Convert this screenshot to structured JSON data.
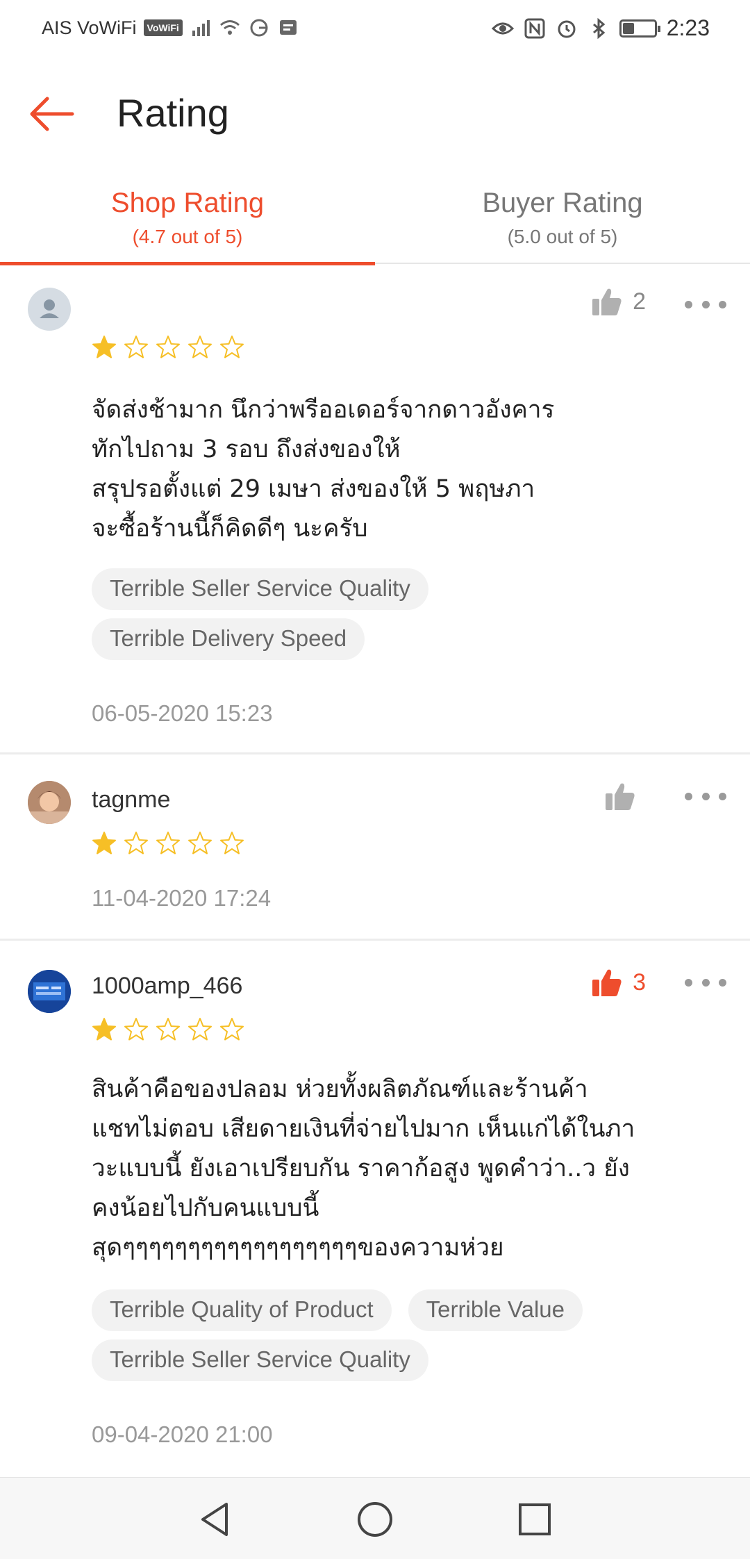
{
  "status_bar": {
    "carrier": "AIS VoWiFi",
    "vowifi_badge": "VoWiFi",
    "time": "2:23",
    "battery_level": 0.35
  },
  "header": {
    "title": "Rating",
    "back_icon": "back-arrow-icon"
  },
  "tabs": [
    {
      "label": "Shop Rating",
      "sublabel": "(4.7 out of 5)",
      "active": true
    },
    {
      "label": "Buyer Rating",
      "sublabel": "(5.0 out of 5)",
      "active": false
    }
  ],
  "reviews": [
    {
      "username": "",
      "avatar": "default-user",
      "likes": "2",
      "liked": false,
      "rating": 1,
      "comment": [
        "จัดส่งช้ามาก นึกว่าพรีออเดอร์จากดาวอังคาร",
        "ทักไปถาม 3 รอบ ถึงส่งของให้",
        "สรุปรอตั้งแต่ 29 เมษา ส่งของให้ 5 พฤษภา",
        "จะซื้อร้านนี้ก็คิดดีๆ นะครับ"
      ],
      "tags": [
        "Terrible Seller Service Quality",
        "Terrible Delivery Speed"
      ],
      "date": "06-05-2020 15:23"
    },
    {
      "username": "tagnme",
      "avatar": "photo",
      "likes": "",
      "liked": false,
      "rating": 1,
      "comment": [],
      "tags": [],
      "date": "11-04-2020 17:24"
    },
    {
      "username": "1000amp_466",
      "avatar": "photo",
      "likes": "3",
      "liked": true,
      "rating": 1,
      "comment": [
        "สินค้าคือของปลอม ห่วยทั้งผลิตภัณฑ์และร้านค้า",
        "แชทไม่ตอบ เสียดายเงินที่จ่ายไปมาก เห็นแก่ได้ในภา",
        "วะแบบนี้ ยังเอาเปรียบกัน ราคาก้อสูง พูดคำว่า..ว ยัง",
        "คงน้อยไปกับคนแบบนี้",
        "สุดๆๆๆๆๆๆๆๆๆๆๆๆๆๆๆๆๆๆของความห่วย"
      ],
      "tags": [
        "Terrible Quality of Product",
        "Terrible Value",
        "Terrible Seller Service Quality"
      ],
      "date": "09-04-2020 21:00"
    }
  ],
  "colors": {
    "accent": "#ee4d2d",
    "star": "#f6bf26",
    "muted": "#999999"
  },
  "nav": {
    "back": "triangle-back-icon",
    "home": "circle-home-icon",
    "recents": "square-recents-icon"
  }
}
